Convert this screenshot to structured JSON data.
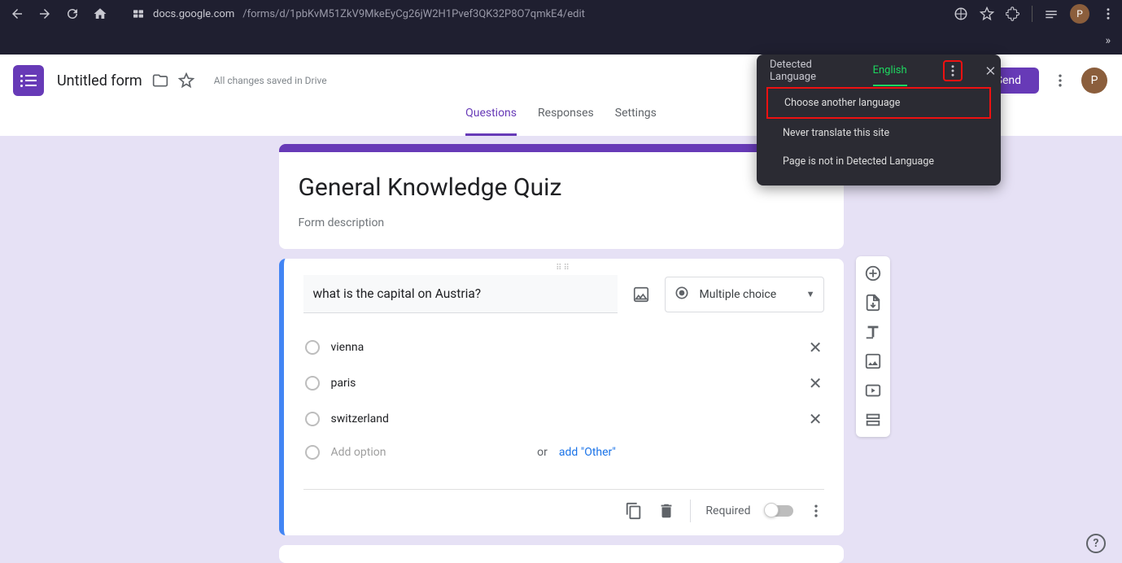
{
  "browser": {
    "url_host": "docs.google.com",
    "url_path": "/forms/d/1pbKvM51ZkV9MkeEyCg26jW2H1Pvef3QK32P8O7qmkE4/edit",
    "avatar_initial": "P"
  },
  "translate": {
    "tab_detect": "Detected Language",
    "tab_english": "English",
    "menu": {
      "choose": "Choose another language",
      "never": "Never translate this site",
      "not_in": "Page is not in Detected Language"
    }
  },
  "header": {
    "form_name": "Untitled form",
    "saved_text": "All changes saved in Drive",
    "send_label": "Send",
    "avatar_initial": "P"
  },
  "tabs": {
    "questions": "Questions",
    "responses": "Responses",
    "settings": "Settings"
  },
  "form": {
    "title": "General Knowledge Quiz",
    "description": "Form description",
    "question": {
      "text": "what is the capital on Austria?",
      "type_label": "Multiple choice",
      "options": [
        "vienna",
        "paris",
        "switzerland"
      ],
      "add_option": "Add option",
      "or_text": "or",
      "add_other": "add \"Other\"",
      "required_label": "Required"
    }
  },
  "help_label": "?"
}
